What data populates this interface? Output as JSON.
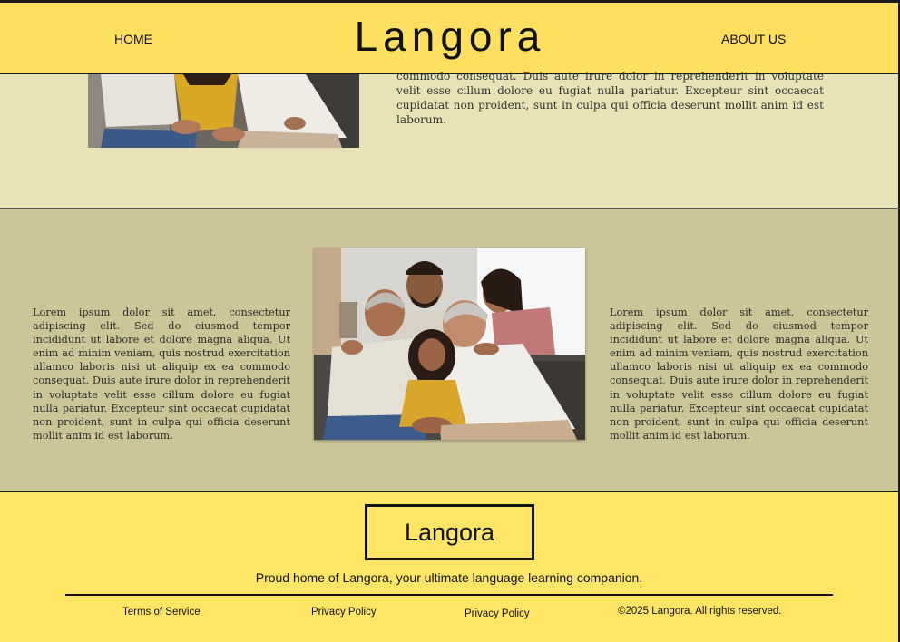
{
  "header": {
    "home_label": "HOME",
    "brand": "Langora",
    "about_label": "ABOUT US"
  },
  "section1": {
    "text": "commodo consequat. Duis aute irure dolor in reprehenderit in voluptate velit esse cillum dolore eu fugiat nulla pariatur. Excepteur sint occaecat cupidatat non proident, sunt in culpa qui officia deserunt mollit anim id est laborum.",
    "background": "#e8e2b6"
  },
  "section2": {
    "left_text": "Lorem ipsum dolor sit amet, consectetur adipiscing elit. Sed do eiusmod tempor incididunt ut labore et dolore magna aliqua. Ut enim ad minim veniam, quis nostrud exercitation ullamco laboris nisi ut aliquip ex ea commodo consequat. Duis aute irure dolor in reprehenderit in voluptate velit esse cillum dolore eu fugiat nulla pariatur. Excepteur sint occaecat cupidatat non proident, sunt in culpa qui officia deserunt mollit anim id est laborum.",
    "right_text": "Lorem ipsum dolor sit amet, consectetur adipiscing elit. Sed do eiusmod tempor incididunt ut labore et dolore magna aliqua. Ut enim ad minim veniam, quis nostrud exercitation ullamco laboris nisi ut aliquip ex ea commodo consequat. Duis aute irure dolor in reprehenderit in voluptate velit esse cillum dolore eu fugiat nulla pariatur. Excepteur sint occaecat cupidatat non proident, sunt in culpa qui officia deserunt mollit anim id est laborum.",
    "background": "#cbc597"
  },
  "footer": {
    "logo": "Langora",
    "tagline": "Proud home of Langora, your ultimate language learning companion.",
    "links": [
      "Terms of Service",
      "Privacy Policy",
      "Privacy Policy"
    ],
    "copyright": "©2025 Langora. All rights reserved.",
    "background": "#ffe566"
  },
  "colors": {
    "header_bg": "#ffdf5f",
    "text": "#111111"
  }
}
